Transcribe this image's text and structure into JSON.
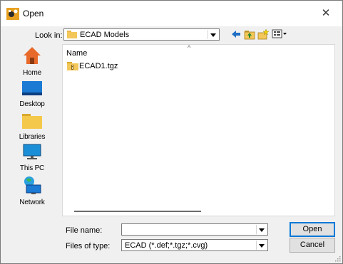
{
  "window": {
    "title": "Open"
  },
  "look_in": {
    "label": "Look in:",
    "value": "ECAD Models"
  },
  "places": [
    {
      "label": "Home",
      "icon": "home-icon"
    },
    {
      "label": "Desktop",
      "icon": "desktop-icon"
    },
    {
      "label": "Libraries",
      "icon": "libraries-icon"
    },
    {
      "label": "This PC",
      "icon": "this-pc-icon"
    },
    {
      "label": "Network",
      "icon": "network-icon"
    }
  ],
  "file_list": {
    "column_header": "Name",
    "sort_indicator": "^",
    "items": [
      {
        "name": "ECAD1.tgz",
        "icon": "archive-file-icon"
      }
    ]
  },
  "file_name": {
    "label": "File name:",
    "value": ""
  },
  "file_type": {
    "label": "Files of type:",
    "value": "ECAD (*.def;*.tgz;*.cvg)"
  },
  "buttons": {
    "open": "Open",
    "cancel": "Cancel"
  }
}
